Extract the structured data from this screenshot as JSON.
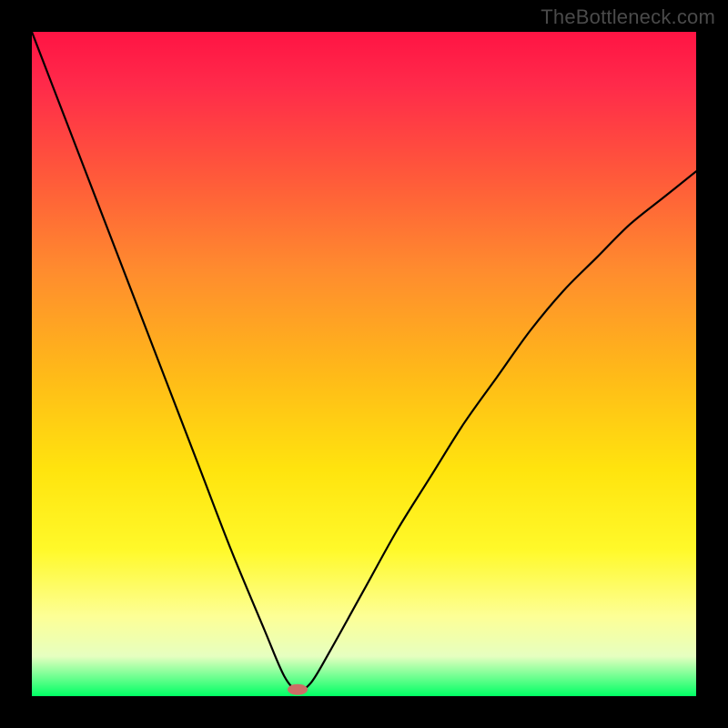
{
  "watermark": "TheBottleneck.com",
  "chart_data": {
    "type": "line",
    "title": "",
    "xlabel": "",
    "ylabel": "",
    "xlim": [
      0,
      100
    ],
    "ylim": [
      0,
      100
    ],
    "grid": false,
    "legend": false,
    "series": [
      {
        "name": "bottleneck-curve",
        "x": [
          0,
          5,
          10,
          15,
          20,
          25,
          30,
          35,
          38,
          40,
          42,
          45,
          50,
          55,
          60,
          65,
          70,
          75,
          80,
          85,
          90,
          95,
          100
        ],
        "values": [
          100,
          87,
          74,
          61,
          48,
          35,
          22,
          10,
          3,
          1,
          2,
          7,
          16,
          25,
          33,
          41,
          48,
          55,
          61,
          66,
          71,
          75,
          79
        ]
      }
    ],
    "marker": {
      "name": "bottleneck-point",
      "x": 40,
      "y": 1,
      "color": "#cc6e66"
    },
    "background_gradient": [
      "#ff1444",
      "#ff8c2e",
      "#ffe40e",
      "#fdff96",
      "#00ff64"
    ]
  }
}
